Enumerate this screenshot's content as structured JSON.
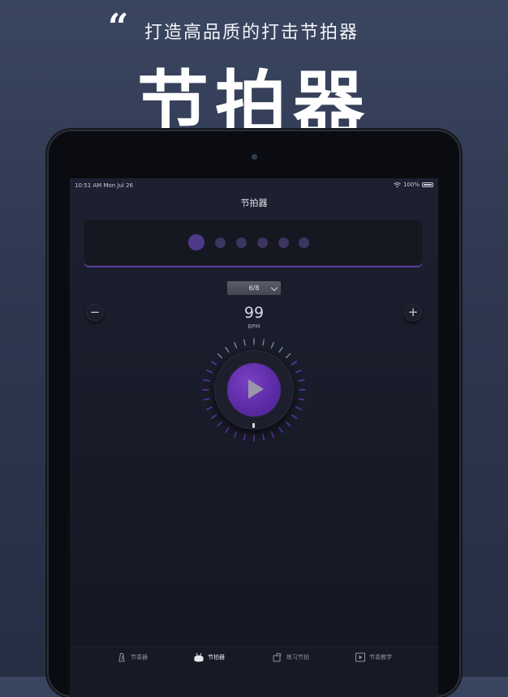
{
  "promo": {
    "quote_mark": "“",
    "tagline": "打造高品质的打击节拍器",
    "title": "节拍器"
  },
  "status_bar": {
    "time": "10:51 AM   Mon Jul 26",
    "battery": "100%"
  },
  "navbar": {
    "title": "节拍器"
  },
  "beats": {
    "count": 6,
    "active_color": "#4e3a88",
    "dot_color": "#3b3560"
  },
  "time_signature": {
    "value": "6/8"
  },
  "tempo": {
    "bpm": "99",
    "unit": "BPM",
    "minus_label": "−",
    "plus_label": "+"
  },
  "accent_color": "#6a34b4",
  "tabs": [
    {
      "label": "节奏器",
      "icon": "metronome-icon"
    },
    {
      "label": "节拍器",
      "icon": "drum-icon"
    },
    {
      "label": "练习节拍",
      "icon": "practice-icon"
    },
    {
      "label": "节奏教学",
      "icon": "video-play-icon"
    }
  ]
}
